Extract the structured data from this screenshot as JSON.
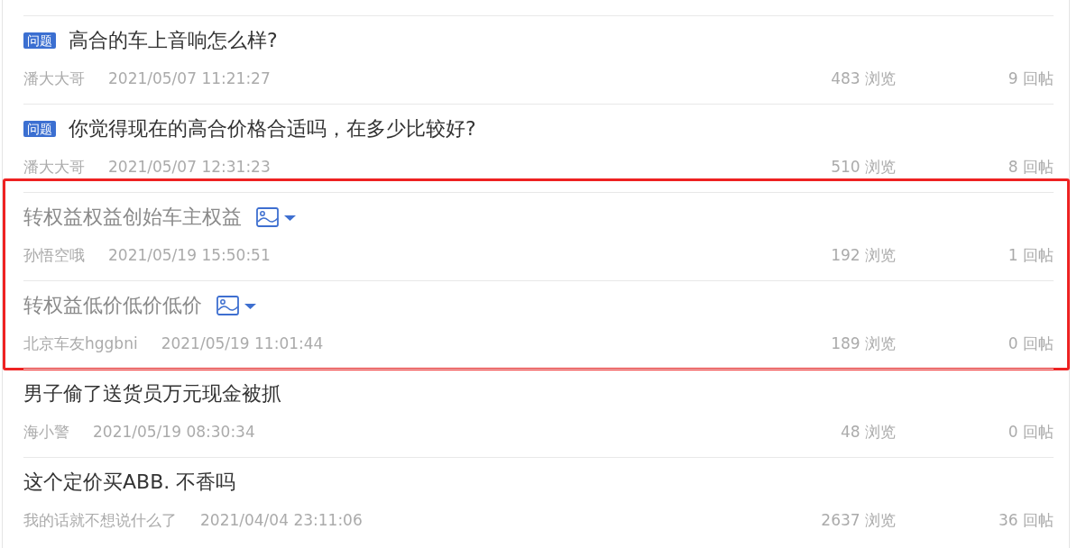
{
  "posts": [
    {
      "tag": "问题",
      "title": "高合的车上音响怎么样?",
      "greyed": false,
      "has_image": false,
      "highlighted": false,
      "author": "潘大大哥",
      "time": "2021/05/07 11:21:27",
      "views": "483 浏览",
      "replies": "9 回帖"
    },
    {
      "tag": "问题",
      "title": "你觉得现在的高合价格合适吗，在多少比较好?",
      "greyed": false,
      "has_image": false,
      "highlighted": false,
      "author": "潘大大哥",
      "time": "2021/05/07 12:31:23",
      "views": "510 浏览",
      "replies": "8 回帖"
    },
    {
      "title": "转权益权益创始车主权益",
      "greyed": true,
      "has_image": true,
      "highlighted": true,
      "author": "孙悟空哦",
      "time": "2021/05/19 15:50:51",
      "views": "192 浏览",
      "replies": "1 回帖"
    },
    {
      "title": "转权益低价低价低价",
      "greyed": true,
      "has_image": true,
      "highlighted": true,
      "author": "北京车友hggbni",
      "time": "2021/05/19 11:01:44",
      "views": "189 浏览",
      "replies": "0 回帖"
    },
    {
      "title": "男子偷了送货员万元现金被抓",
      "greyed": false,
      "has_image": false,
      "highlighted": false,
      "author": "海小警",
      "time": "2021/05/19 08:30:34",
      "views": "48 浏览",
      "replies": "0 回帖"
    },
    {
      "title": "这个定价买ABB. 不香吗",
      "greyed": false,
      "has_image": false,
      "highlighted": false,
      "author": "我的话就不想说什么了",
      "time": "2021/04/04 23:11:06",
      "views": "2637 浏览",
      "replies": "36 回帖"
    }
  ]
}
